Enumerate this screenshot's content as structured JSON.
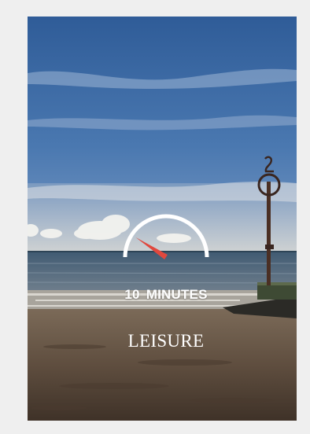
{
  "card": {
    "gauge": {
      "level": 0.18,
      "needle_color": "#e0483e",
      "arc_color": "#ffffff"
    },
    "duration": {
      "value": "10",
      "unit": "MINUTES"
    },
    "category": "LEISURE"
  }
}
